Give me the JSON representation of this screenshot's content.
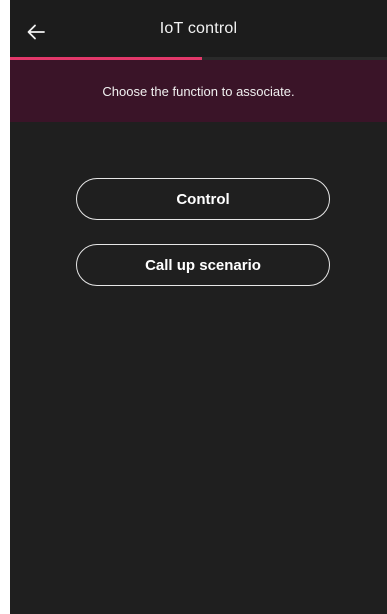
{
  "header": {
    "title": "IoT control",
    "back_icon": "arrow-left-icon"
  },
  "progress": {
    "fraction": 0.51,
    "color": "#e2386a"
  },
  "banner": {
    "text": "Choose the function to associate.",
    "background": "#3a1428"
  },
  "options": [
    {
      "label": "Control"
    },
    {
      "label": "Call up scenario"
    }
  ]
}
